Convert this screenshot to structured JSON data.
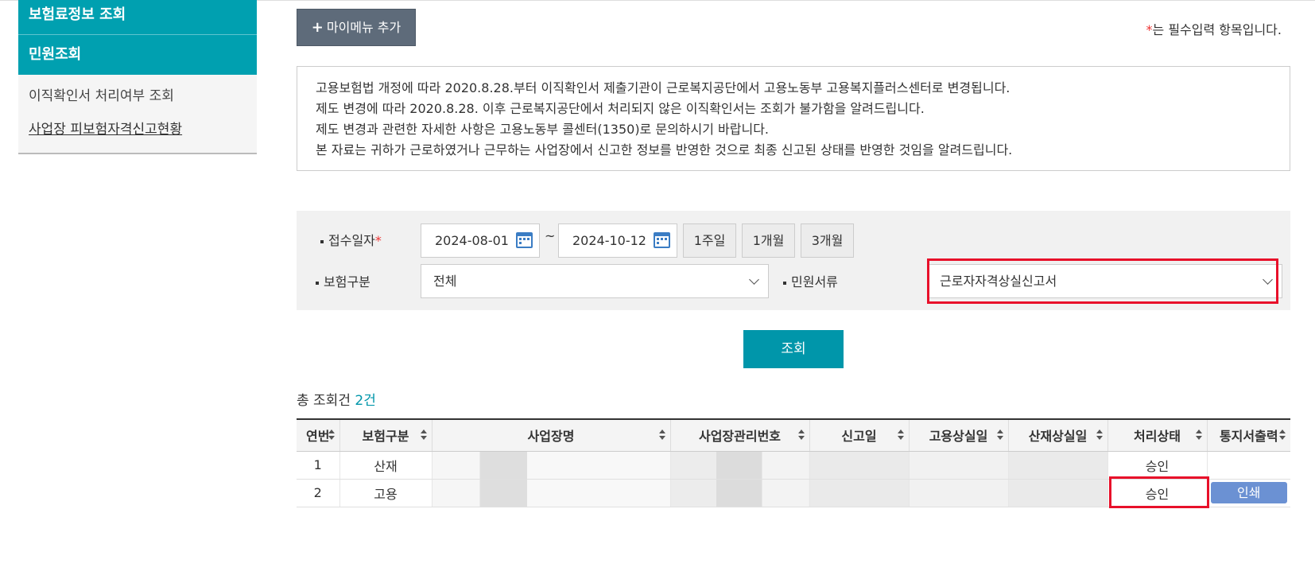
{
  "sidebar": {
    "item_insurance_info": "보험료정보 조회",
    "item_civil": "민원조회",
    "sub_items": [
      "이직확인서 처리여부 조회",
      "사업장 피보험자격신고현황"
    ]
  },
  "header": {
    "mymenu_plus": "+",
    "mymenu_label": "마이메뉴 추가",
    "required_star": "*",
    "required_note": "는 필수입력 항목입니다."
  },
  "notice": {
    "lines": [
      "고용보험법 개정에 따라 2020.8.28.부터 이직확인서 제출기관이 근로복지공단에서 고용노동부 고용복지플러스센터로 변경됩니다.",
      "제도 변경에 따라 2020.8.28. 이후 근로복지공단에서 처리되지 않은 이직확인서는 조회가 불가함을 알려드립니다.",
      "제도 변경과 관련한 자세한 사항은 고용노동부 콜센터(1350)로 문의하시기 바랍니다.",
      "본 자료는 귀하가 근로하였거나 근무하는 사업장에서 신고한 정보를 반영한 것으로 최종 신고된 상태를 반영한 것임을 알려드립니다."
    ]
  },
  "search": {
    "date_label": "접수일자",
    "required_star": "*",
    "date_from": "2024-08-01",
    "tilde": "~",
    "date_to": "2024-10-12",
    "period_1w": "1주일",
    "period_1m": "1개월",
    "period_3m": "3개월",
    "insurance_label": "보험구분",
    "insurance_value": "전체",
    "doc_label": "민원서류",
    "doc_value": "근로자자격상실신고서",
    "query_label": "조회"
  },
  "summary": {
    "total_label": "총 조회건",
    "total_count": "2건"
  },
  "table": {
    "headers": [
      "연번",
      "보험구분",
      "사업장명",
      "사업장관리번호",
      "신고일",
      "고용상실일",
      "산재상실일",
      "처리상태",
      "통지서출력"
    ],
    "rows": [
      {
        "no": "1",
        "type": "산재",
        "status": "승인",
        "print": ""
      },
      {
        "no": "2",
        "type": "고용",
        "status": "승인",
        "print": "인쇄"
      }
    ]
  },
  "colors": {
    "teal": "#00a0b0",
    "query_button": "#0096aa",
    "print_button": "#6b91d3",
    "highlight_red": "#e8102a"
  }
}
